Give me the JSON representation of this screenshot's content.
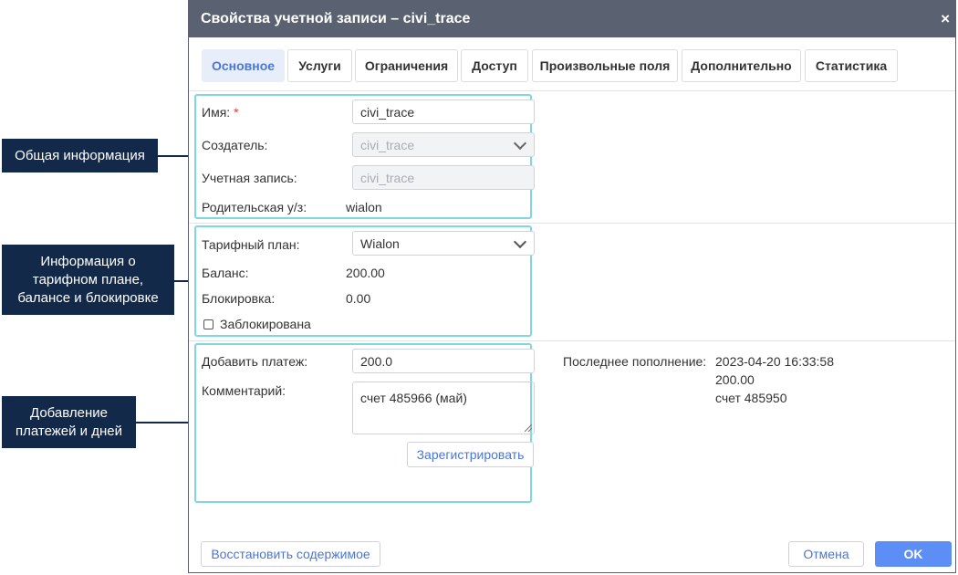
{
  "dialog": {
    "title": "Свойства учетной записи – civi_trace",
    "close_glyph": "×"
  },
  "tabs": [
    {
      "label": "Основное",
      "active": true
    },
    {
      "label": "Услуги"
    },
    {
      "label": "Ограничения"
    },
    {
      "label": "Доступ"
    },
    {
      "label": "Произвольные поля"
    },
    {
      "label": "Дополнительно"
    },
    {
      "label": "Статистика"
    }
  ],
  "general": {
    "name_label": "Имя:",
    "required_mark": "*",
    "name_value": "civi_trace",
    "creator_label": "Создатель:",
    "creator_value": "civi_trace",
    "account_label": "Учетная запись:",
    "account_value": "civi_trace",
    "parent_label": "Родительская у/з:",
    "parent_value": "wialon"
  },
  "tariff": {
    "plan_label": "Тарифный план:",
    "plan_value": "Wialon",
    "balance_label": "Баланс:",
    "balance_value": "200.00",
    "block_label": "Блокировка:",
    "block_value": "0.00",
    "blocked_label": "Заблокирована",
    "blocked_checked": false
  },
  "payment": {
    "add_label": "Добавить платеж:",
    "add_value": "200.0",
    "comment_label": "Комментарий:",
    "comment_value": "счет 485966 (май)",
    "register_button": "Зарегистрировать",
    "last_label": "Последнее пополнение:",
    "last_date": "2023-04-20 16:33:58",
    "last_amount": "200.00",
    "last_comment": "счет 485950"
  },
  "footer": {
    "restore_button": "Восстановить содержимое",
    "cancel_button": "Отмена",
    "ok_button": "OK"
  },
  "callouts": {
    "general": "Общая информация",
    "tariff": "Информация о тарифном плане, балансе и блокировке",
    "payments": "Добавление платежей и дней"
  },
  "colors": {
    "titlebar": "#5a6170",
    "accent": "#4a76d4",
    "ok_button": "#5d8ef5",
    "section_outline": "#7fd8e0",
    "callout_bg": "#13294a",
    "required": "#e03b3b"
  }
}
